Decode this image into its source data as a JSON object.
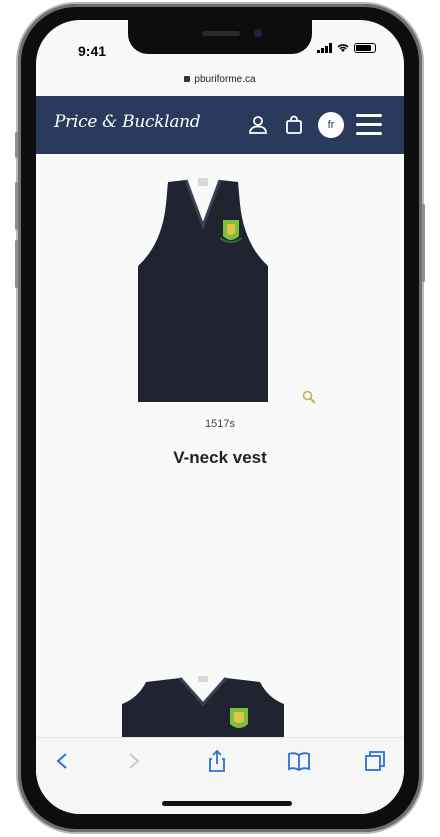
{
  "status_bar": {
    "time": "9:41"
  },
  "browser": {
    "url": "pburiforme.ca"
  },
  "header": {
    "logo_text": "Price & Buckland",
    "language_label": "fr",
    "background_color": "#293a5c",
    "icons": [
      "user-icon",
      "shopping-bag-icon",
      "menu-icon"
    ]
  },
  "product": {
    "sku": "1517s",
    "name": "V-neck vest",
    "garment_color": "#1f2430",
    "crest_colors": [
      "#7fbf3a",
      "#e1c34a"
    ]
  },
  "toolbar": {
    "icons": [
      "back-icon",
      "forward-icon",
      "share-icon",
      "bookmarks-icon",
      "tabs-icon"
    ],
    "accent_color": "#2f6fd6"
  }
}
